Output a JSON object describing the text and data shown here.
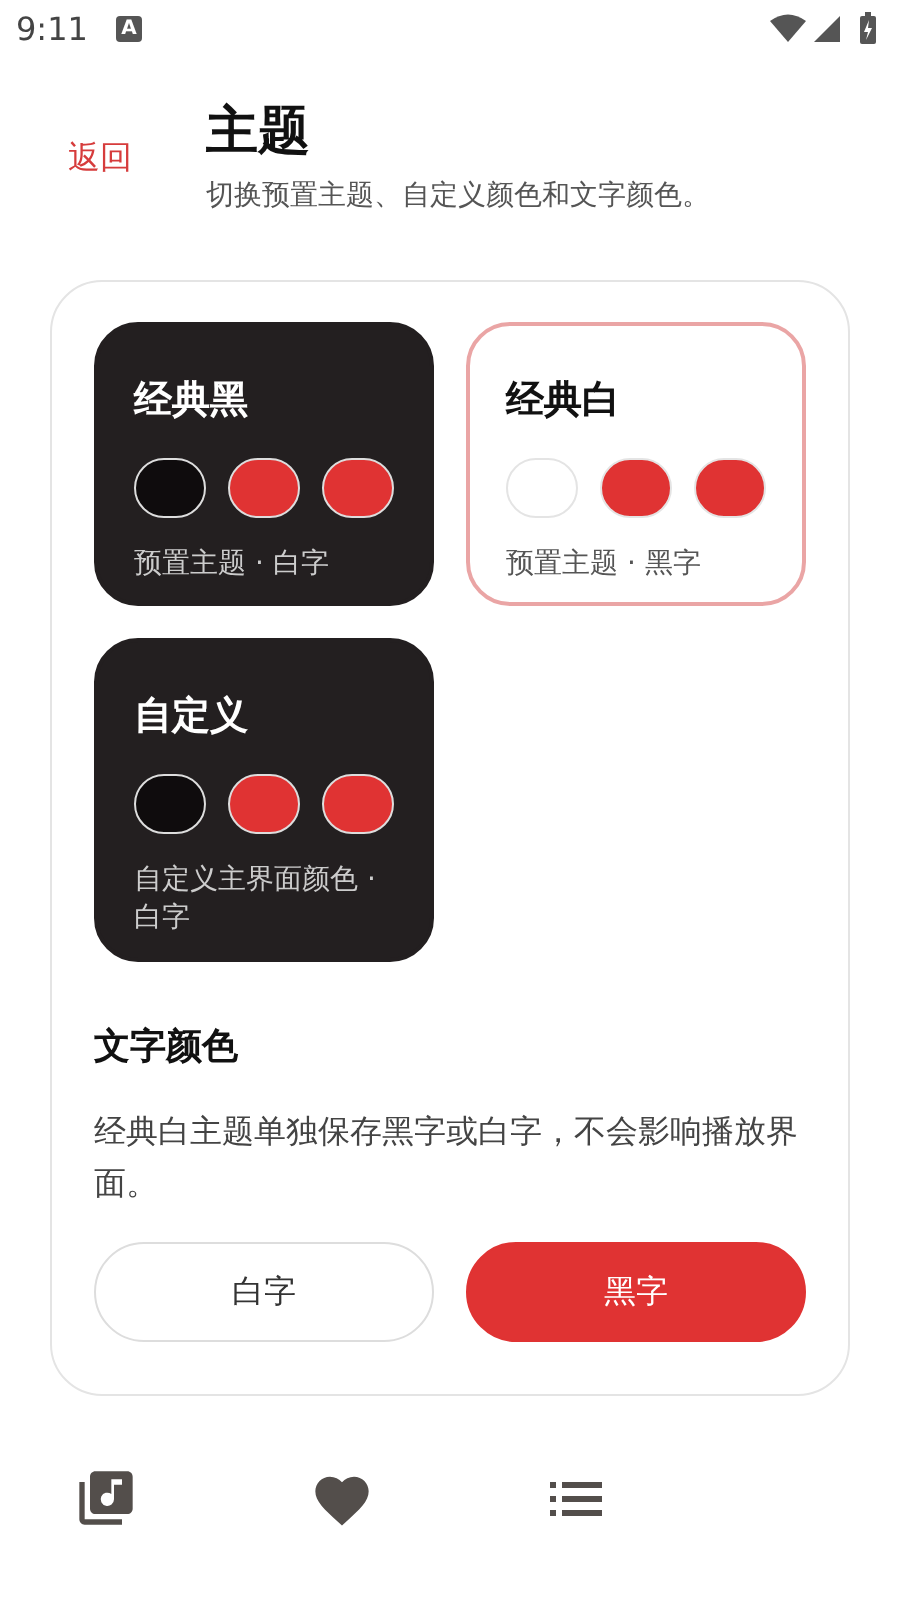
{
  "status_bar": {
    "time": "9:11",
    "notification": "A"
  },
  "header": {
    "back": "返回",
    "title": "主题",
    "subtitle": "切换预置主题、自定义颜色和文字颜色。"
  },
  "themes": [
    {
      "name": "经典黑",
      "dark": true,
      "selected": false,
      "swatches": [
        {
          "color": "#0f0c0d"
        },
        {
          "color": "#e03333"
        },
        {
          "color": "#e03333"
        }
      ],
      "caption": "预置主题 · 白字"
    },
    {
      "name": "经典白",
      "dark": false,
      "selected": true,
      "swatches": [
        {
          "color": "#ffffff"
        },
        {
          "color": "#e03333"
        },
        {
          "color": "#e03333"
        }
      ],
      "caption": "预置主题 · 黑字"
    },
    {
      "name": "自定义",
      "dark": true,
      "selected": false,
      "swatches": [
        {
          "color": "#0f0c0d"
        },
        {
          "color": "#e03333"
        },
        {
          "color": "#e03333"
        }
      ],
      "caption": "自定义主界面颜色 · 白字"
    }
  ],
  "text_color": {
    "title": "文字颜色",
    "description": "经典白主题单独保存黑字或白字，不会影响播放界面。",
    "options": [
      {
        "label": "白字",
        "selected": false
      },
      {
        "label": "黑字",
        "selected": true
      }
    ]
  },
  "bottom_nav": [
    {
      "kind": "library",
      "selected": false
    },
    {
      "kind": "heart",
      "selected": false
    },
    {
      "kind": "list",
      "selected": false
    }
  ]
}
